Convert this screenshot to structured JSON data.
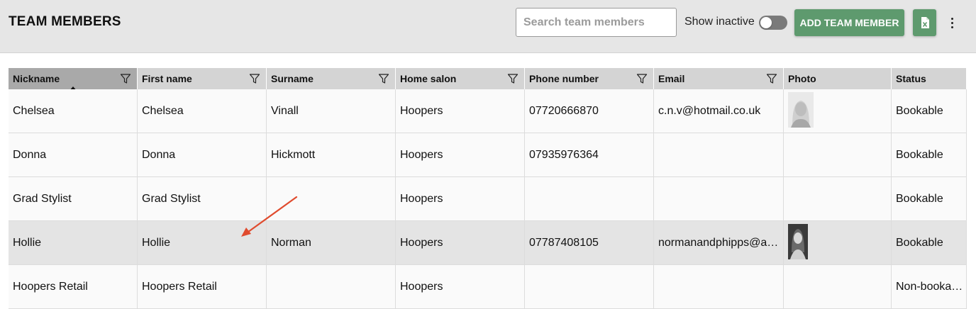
{
  "header": {
    "title": "TEAM MEMBERS",
    "search_placeholder": "Search team members",
    "show_inactive_label": "Show inactive",
    "show_inactive": false,
    "add_button_label": "ADD TEAM MEMBER",
    "export_icon": "excel-export-icon",
    "more_icon": "more-vertical-icon"
  },
  "colors": {
    "header_bar": "#e6e6e6",
    "accent_green": "#5e9a6e",
    "table_header": "#d4d4d4",
    "sorted_header": "#a9a9a9",
    "row_highlight": "#e4e4e4",
    "annotation_arrow": "#e04b2e"
  },
  "table": {
    "sort": {
      "column": "Nickname",
      "direction": "ascending"
    },
    "columns": [
      {
        "label": "Nickname",
        "filter": true
      },
      {
        "label": "First name",
        "filter": true
      },
      {
        "label": "Surname",
        "filter": true
      },
      {
        "label": "Home salon",
        "filter": true
      },
      {
        "label": "Phone number",
        "filter": true
      },
      {
        "label": "Email",
        "filter": true
      },
      {
        "label": "Photo",
        "filter": false
      },
      {
        "label": "Status",
        "filter": false
      }
    ],
    "rows": [
      {
        "nickname": "Chelsea",
        "first_name": "Chelsea",
        "surname": "Vinall",
        "home_salon": "Hoopers",
        "phone": "07720666870",
        "email": "c.n.v@hotmail.co.uk",
        "photo": true,
        "status": "Bookable"
      },
      {
        "nickname": "Donna",
        "first_name": "Donna",
        "surname": "Hickmott",
        "home_salon": "Hoopers",
        "phone": "07935976364",
        "email": "",
        "photo": false,
        "status": "Bookable"
      },
      {
        "nickname": "Grad Stylist",
        "first_name": "Grad Stylist",
        "surname": "",
        "home_salon": "Hoopers",
        "phone": "",
        "email": "",
        "photo": false,
        "status": "Bookable"
      },
      {
        "nickname": "Hollie",
        "first_name": "Hollie",
        "surname": "Norman",
        "home_salon": "Hoopers",
        "phone": "07787408105",
        "email": "normanandphipps@a…",
        "photo": true,
        "status": "Bookable",
        "highlighted": true
      },
      {
        "nickname": "Hoopers Retail",
        "first_name": "Hoopers Retail",
        "surname": "",
        "home_salon": "Hoopers",
        "phone": "",
        "email": "",
        "photo": false,
        "status": "Non-bookable"
      }
    ]
  }
}
